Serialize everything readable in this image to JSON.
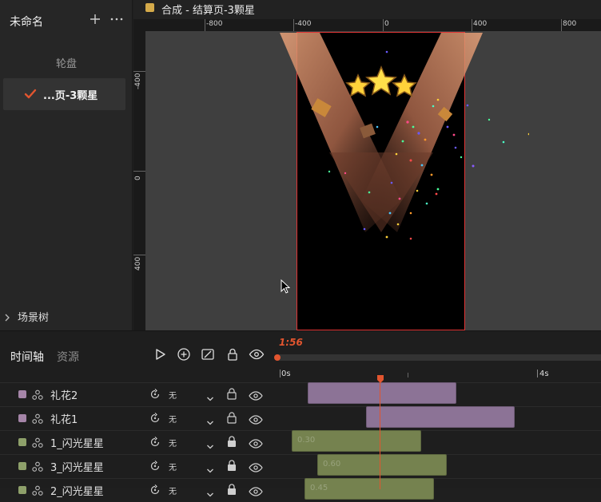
{
  "sidebar": {
    "title": "未命名",
    "group_label": "轮盘",
    "active_item": "...页-3颗星",
    "scene_tree_label": "场景树"
  },
  "canvas": {
    "title": "合成 - 结算页-3颗星",
    "swatch_color": "#d4aa4a",
    "ruler_x_labels": [
      "-800",
      "-400",
      "0",
      "400",
      "800"
    ],
    "ruler_y_labels": [
      "-400",
      "0",
      "400"
    ],
    "stage_border_color": "#e03434"
  },
  "timeline": {
    "tab_timeline": "时间轴",
    "tab_assets": "资源",
    "time_code": "1:56",
    "ruler_start": "0s",
    "ruler_mark": "4s",
    "accent_color": "#e2552f",
    "tracks": [
      {
        "name": "礼花2",
        "blend": "无",
        "color": "#a585a8",
        "locked": false,
        "clip_label": ""
      },
      {
        "name": "礼花1",
        "blend": "无",
        "color": "#a585a8",
        "locked": false,
        "clip_label": ""
      },
      {
        "name": "1_闪光星星",
        "blend": "无",
        "color": "#8ea06a",
        "locked": true,
        "clip_label": "0.30"
      },
      {
        "name": "3_闪光星星",
        "blend": "无",
        "color": "#8ea06a",
        "locked": true,
        "clip_label": "0.60"
      },
      {
        "name": "2_闪光星星",
        "blend": "无",
        "color": "#8ea06a",
        "locked": true,
        "clip_label": "0.45"
      }
    ]
  }
}
